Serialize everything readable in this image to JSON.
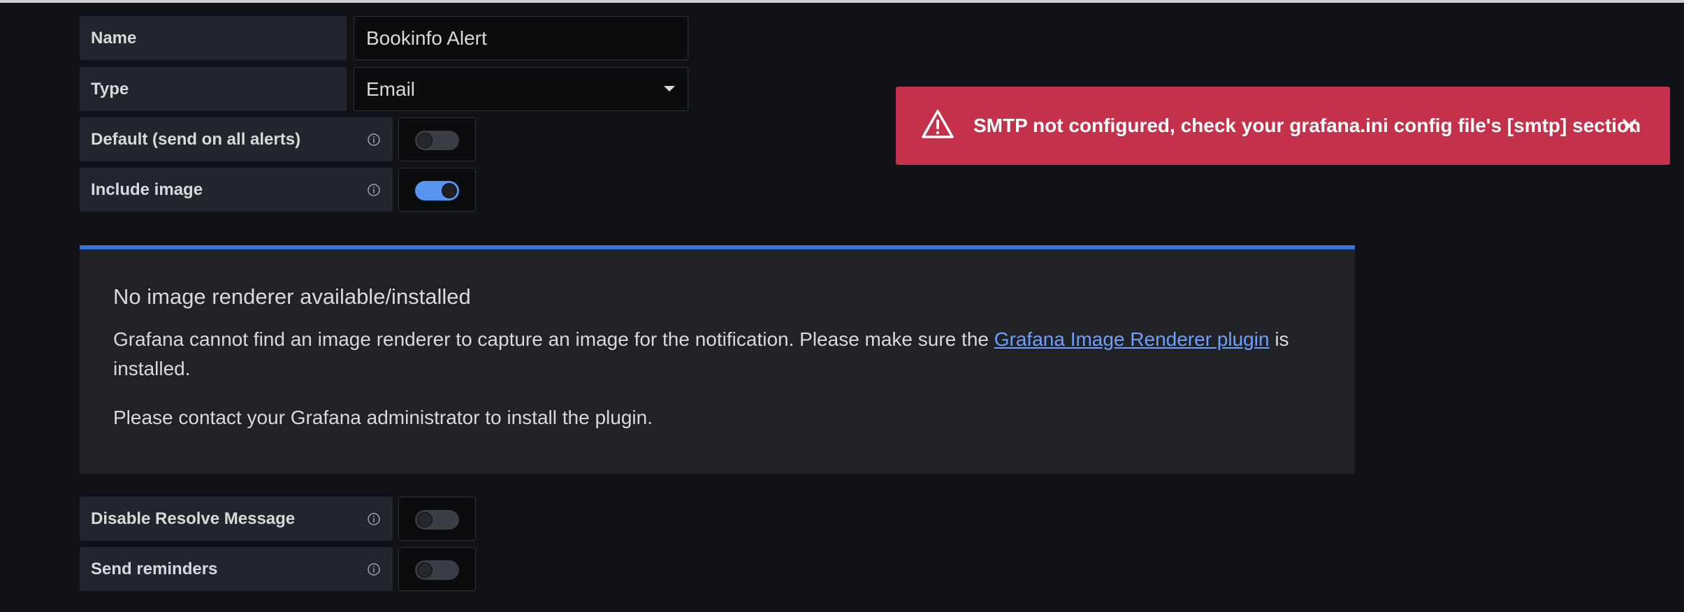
{
  "form": {
    "name": {
      "label": "Name",
      "value": "Bookinfo Alert"
    },
    "type": {
      "label": "Type",
      "value": "Email"
    },
    "default_alerts": {
      "label": "Default (send on all alerts)",
      "checked": false
    },
    "include_image": {
      "label": "Include image",
      "checked": true
    },
    "disable_resolve": {
      "label": "Disable Resolve Message",
      "checked": false
    },
    "send_reminders": {
      "label": "Send reminders",
      "checked": false
    }
  },
  "renderer_notice": {
    "title": "No image renderer available/installed",
    "text_before_link": "Grafana cannot find an image renderer to capture an image for the notification. Please make sure the ",
    "link_text": "Grafana Image Renderer plugin",
    "text_after_link": " is installed.",
    "contact_text": "Please contact your Grafana administrator to install the plugin."
  },
  "toast": {
    "message": "SMTP not configured, check your grafana.ini config file's [smtp] section",
    "icon": "warning-icon",
    "color": "#c4314b"
  },
  "colors": {
    "accent": "#3871dc",
    "link": "#6e9fff",
    "switch_on": "#5794f2",
    "background": "#111217"
  }
}
